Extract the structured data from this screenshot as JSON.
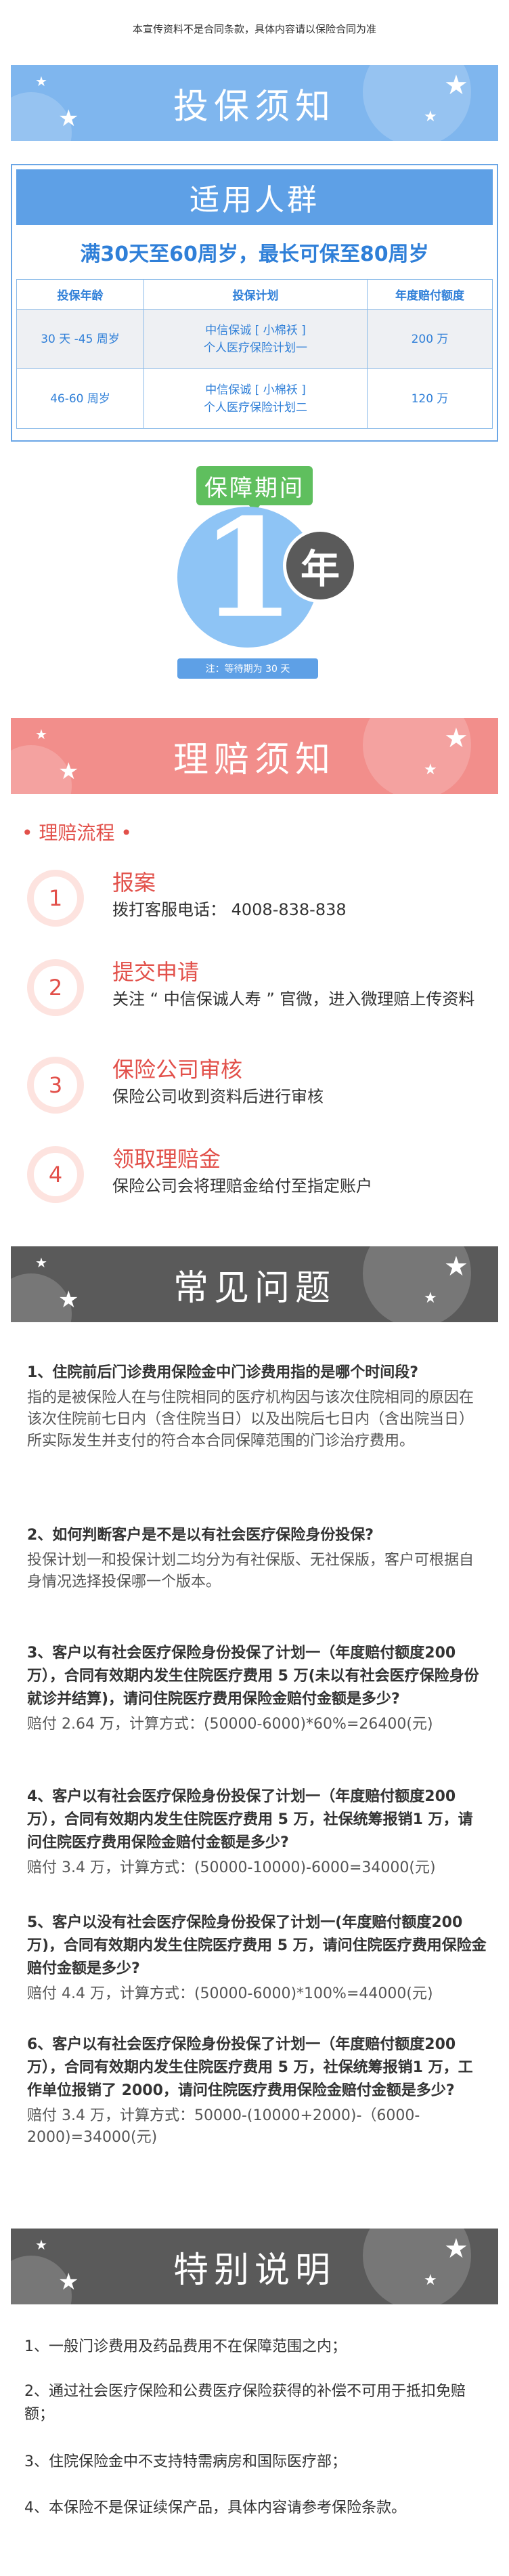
{
  "disclaimer": "本宣传资料不是合同条款，具体内容请以保险合同为准",
  "banners": {
    "notice": "投保须知",
    "claim": "理赔须知",
    "faq": "常见问题",
    "special": "特别说明"
  },
  "eligibility": {
    "title": "适用人群",
    "subtitle": "满30天至60周岁，最长可保至80周岁",
    "headers": [
      "投保年龄",
      "投保计划",
      "年度赔付额度"
    ],
    "rows": [
      {
        "age": "30 天 -45 周岁",
        "plan_line1": "中信保诚 [ 小棉袄 ]",
        "plan_line2": "个人医疗保险计划一",
        "amount": "200 万"
      },
      {
        "age": "46-60 周岁",
        "plan_line1": "中信保诚 [ 小棉袄 ]",
        "plan_line2": "个人医疗保险计划二",
        "amount": "120 万"
      }
    ]
  },
  "period": {
    "label": "保障期间",
    "number": "1",
    "unit": "年",
    "note": "注：等待期为 30 天"
  },
  "claim_flow": {
    "title": "• 理赔流程 •",
    "steps": [
      {
        "num": "1",
        "head": "报案",
        "desc": "拨打客服电话：  4008-838-838"
      },
      {
        "num": "2",
        "head": "提交申请",
        "desc": "关注 “ 中信保诚人寿 ” 官微，进入微理赔上传资料"
      },
      {
        "num": "3",
        "head": "保险公司审核",
        "desc": "保险公司收到资料后进行审核"
      },
      {
        "num": "4",
        "head": "领取理赔金",
        "desc": "保险公司会将理赔金给付至指定账户"
      }
    ]
  },
  "faq": [
    {
      "q": "1、住院前后门诊费用保险金中门诊费用指的是哪个时间段?",
      "a": "指的是被保险人在与住院相同的医疗机构因与该次住院相同的原因在该次住院前七日内（含住院当日）以及出院后七日内（含出院当日）所实际发生并支付的符合本合同保障范围的门诊治疗费用。"
    },
    {
      "q": "2、如何判断客户是不是以有社会医疗保险身份投保?",
      "a": "投保计划一和投保计划二均分为有社保版、无社保版，客户可根据自身情况选择投保哪一个版本。"
    },
    {
      "q": "3、客户以有社会医疗保险身份投保了计划一（年度赔付额度200 万），合同有效期内发生住院医疗费用 5 万(未以有社会医疗保险身份就诊并结算)，请问住院医疗费用保险金赔付金额是多少?",
      "a": "赔付 2.64 万，计算方式：(50000-6000)*60%=26400(元)"
    },
    {
      "q": "4、客户以有社会医疗保险身份投保了计划一（年度赔付额度200 万），合同有效期内发生住院医疗费用 5 万，社保统筹报销1 万，请问住院医疗费用保险金赔付金额是多少?",
      "a": "赔付 3.4 万，计算方式：(50000-10000)-6000=34000(元)"
    },
    {
      "q": "5、客户以没有社会医疗保险身份投保了计划一(年度赔付额度200 万)，合同有效期内发生住院医疗费用 5 万，请问住院医疗费用保险金赔付金额是多少?",
      "a": "赔付 4.4 万，计算方式：(50000-6000)*100%=44000(元)"
    },
    {
      "q": "6、客户以有社会医疗保险身份投保了计划一（年度赔付额度200 万），合同有效期内发生住院医疗费用 5 万，社保统筹报销1 万，工作单位报销了 2000，请问住院医疗费用保险金赔付金额是多少?",
      "a": "赔付 3.4 万，计算方式：50000-(10000+2000)-（6000-2000)=34000(元)"
    }
  ],
  "special_notes": [
    "1、一般门诊费用及药品费用不在保障范围之内；",
    "2、通过社会医疗保险和公费医疗保险获得的补偿不可用于抵扣免赔额；",
    "3、住院保险金中不支持特需病房和国际医疗部；",
    "4、本保险不是保证续保产品，具体内容请参考保险条款。"
  ],
  "colors": {
    "blue": "#7fb6ee",
    "red": "#f28e8b",
    "gray": "#5a5a5a",
    "green": "#5fbf5e",
    "accent_red": "#e2504a"
  }
}
